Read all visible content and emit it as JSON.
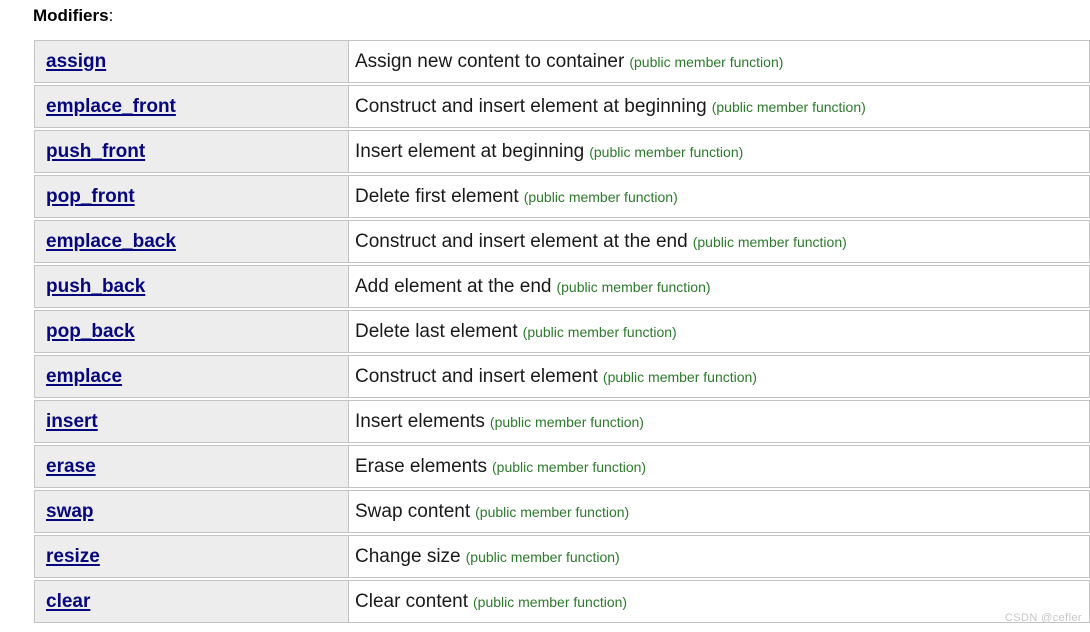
{
  "heading": {
    "text": "Modifiers",
    "colon": ":"
  },
  "colors": {
    "link": "#07067f",
    "note": "#2c7a2c",
    "row_background": "#ededed",
    "border": "#c3c3c3",
    "watermark": "#c6c6c6"
  },
  "table": {
    "rows": [
      {
        "name": "assign",
        "description": "Assign new content to container",
        "note": "(public member function)"
      },
      {
        "name": "emplace_front",
        "description": "Construct and insert element at beginning",
        "note": "(public member function)"
      },
      {
        "name": "push_front",
        "description": "Insert element at beginning",
        "note": "(public member function)"
      },
      {
        "name": "pop_front",
        "description": "Delete first element",
        "note": "(public member function)"
      },
      {
        "name": "emplace_back",
        "description": "Construct and insert element at the end",
        "note": "(public member function)"
      },
      {
        "name": "push_back",
        "description": "Add element at the end",
        "note": "(public member function)"
      },
      {
        "name": "pop_back",
        "description": "Delete last element",
        "note": "(public member function)"
      },
      {
        "name": "emplace",
        "description": "Construct and insert element",
        "note": "(public member function)"
      },
      {
        "name": "insert",
        "description": "Insert elements",
        "note": "(public member function)"
      },
      {
        "name": "erase",
        "description": "Erase elements",
        "note": "(public member function)"
      },
      {
        "name": "swap",
        "description": "Swap content",
        "note": "(public member function)"
      },
      {
        "name": "resize",
        "description": "Change size",
        "note": "(public member function)"
      },
      {
        "name": "clear",
        "description": "Clear content",
        "note": "(public member function)"
      }
    ]
  },
  "watermark": {
    "text": "CSDN @cefler"
  }
}
